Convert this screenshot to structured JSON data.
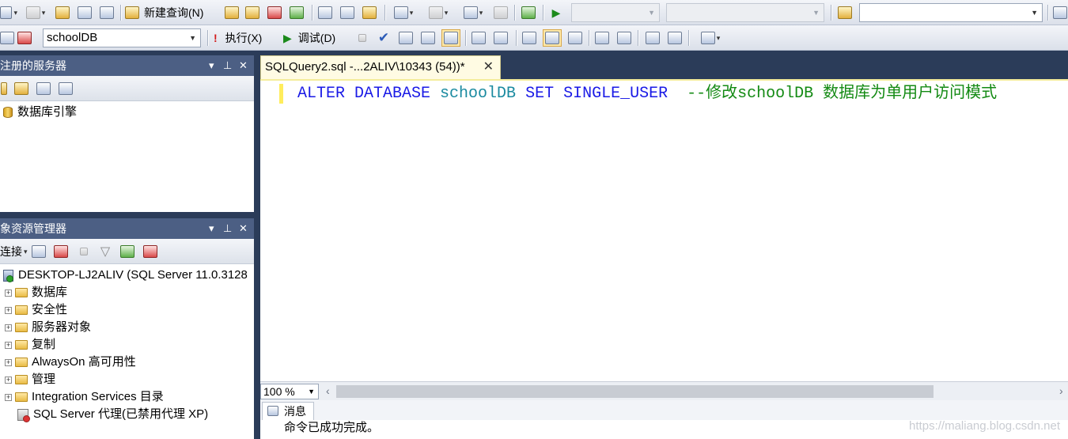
{
  "toolbar1": {
    "new_query_label": "新建查询(N)",
    "combo_search_value": ""
  },
  "toolbar2": {
    "database_selector": "schoolDB",
    "execute_label": "执行(X)",
    "debug_label": "调试(D)"
  },
  "registered_servers": {
    "title": "注册的服务器",
    "root_item": "数据库引擎"
  },
  "object_explorer": {
    "title": "象资源管理器",
    "connect_label": "连接",
    "server_node": "DESKTOP-LJ2ALIV (SQL Server 11.0.3128",
    "children": [
      {
        "label": "数据库"
      },
      {
        "label": "安全性"
      },
      {
        "label": "服务器对象"
      },
      {
        "label": "复制"
      },
      {
        "label": "AlwaysOn 高可用性"
      },
      {
        "label": "管理"
      },
      {
        "label": "Integration Services 目录"
      }
    ],
    "agent_node": "SQL Server 代理(已禁用代理 XP)"
  },
  "document": {
    "tab_title": "SQLQuery2.sql -...2ALIV\\10343 (54))*",
    "close_glyph": "✕",
    "code": {
      "kw1": "ALTER DATABASE",
      "db_name": "schoolDB",
      "kw2": "SET SINGLE_USER",
      "comment": "--修改schoolDB 数据库为单用户访问模式"
    },
    "zoom": "100 %",
    "results_tab": "消息",
    "result_message": "命令已成功完成。"
  },
  "watermark": "https://maliang.blog.csdn.net",
  "colors": {
    "keyword": "#1a1ae6",
    "identifier": "#1a8aa0",
    "comment": "#138a13",
    "panel_title_bg": "#4c5f84",
    "workspace_bg": "#2b3c59"
  }
}
